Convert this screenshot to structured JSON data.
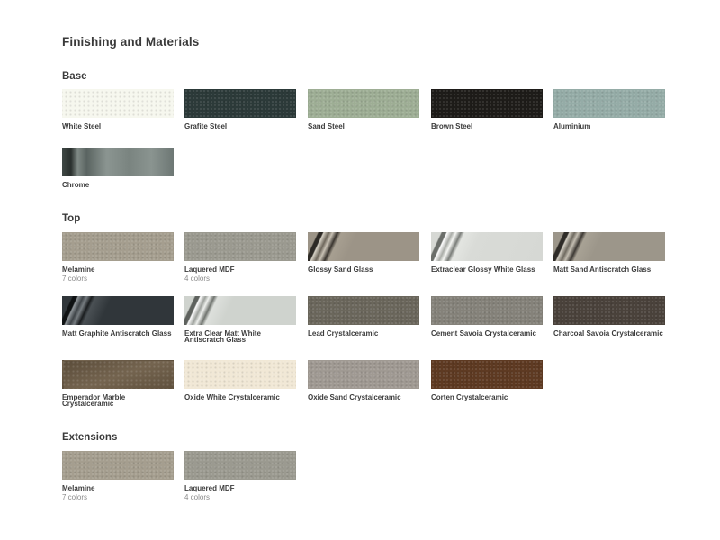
{
  "page": {
    "title": "Finishing and Materials"
  },
  "sections": {
    "base": {
      "title": "Base",
      "items": [
        {
          "label": "White Steel",
          "color": "#f6f7ee"
        },
        {
          "label": "Grafite Steel",
          "color": "#2c3a39"
        },
        {
          "label": "Sand Steel",
          "color": "#9eae95"
        },
        {
          "label": "Brown Steel",
          "color": "#1e1c19"
        },
        {
          "label": "Aluminium",
          "color": "#95aca7"
        },
        {
          "label": "Chrome",
          "color": "#5f6a66"
        }
      ]
    },
    "top": {
      "title": "Top",
      "items": [
        {
          "label": "Melamine",
          "sub": "7 colors",
          "color": "#a59e8f"
        },
        {
          "label": "Laquered MDF",
          "sub": "4 colors",
          "color": "#9b9a90"
        },
        {
          "label": "Glossy Sand Glass",
          "color": "#9c9487"
        },
        {
          "label": "Extraclear Glossy White Glass",
          "color": "#d6d8d4"
        },
        {
          "label": "Matt Sand Antiscratch Glass",
          "color": "#9c968a"
        },
        {
          "label": "Matt Graphite Antiscratch Glass",
          "color": "#30363a"
        },
        {
          "label": "Extra Clear Matt White Antiscratch Glass",
          "color": "#cfd3ce"
        },
        {
          "label": "Lead Crystalceramic",
          "color": "#6b675c"
        },
        {
          "label": "Cement Savoia Crystalceramic",
          "color": "#85827a"
        },
        {
          "label": "Charcoal Savoia Crystalceramic",
          "color": "#4a423b"
        },
        {
          "label": "Emperador Marble Crystalceramic",
          "color": "#6b5a44"
        },
        {
          "label": "Oxide White Crystalceramic",
          "color": "#f1e8d6"
        },
        {
          "label": "Oxide Sand Crystalceramic",
          "color": "#a09a93"
        },
        {
          "label": "Corten Crystalceramic",
          "color": "#5e3a22"
        }
      ]
    },
    "extensions": {
      "title": "Extensions",
      "items": [
        {
          "label": "Melamine",
          "sub": "7 colors",
          "color": "#a59e8f"
        },
        {
          "label": "Laquered MDF",
          "sub": "4 colors",
          "color": "#9b9a90"
        }
      ]
    }
  }
}
